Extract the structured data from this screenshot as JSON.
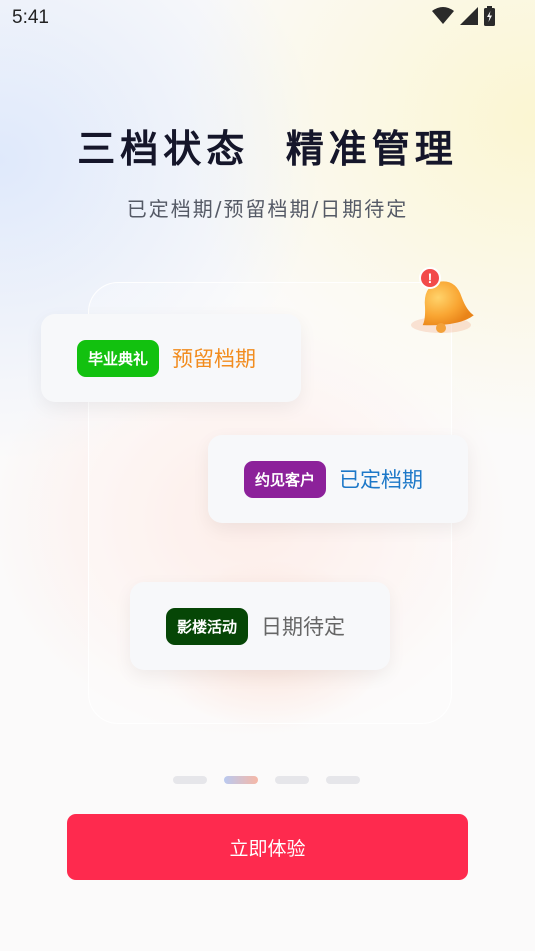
{
  "status_bar": {
    "time": "5:41",
    "icons": [
      "wifi-icon",
      "signal-icon",
      "battery-charging-icon"
    ]
  },
  "header": {
    "title": "三档状态  精准管理",
    "subtitle": "已定档期/预留档期/日期待定"
  },
  "cards": [
    {
      "tag": "毕业典礼",
      "tag_color": "#12c10f",
      "status": "预留档期",
      "status_color": "#f28c1e"
    },
    {
      "tag": "约见客户",
      "tag_color": "#8c219a",
      "status": "已定档期",
      "status_color": "#1d78c8"
    },
    {
      "tag": "影楼活动",
      "tag_color": "#064606",
      "status": "日期待定",
      "status_color": "#666666"
    }
  ],
  "pager": {
    "count": 4,
    "active_index": 1
  },
  "cta": {
    "label": "立即体验",
    "color": "#fe2a4e"
  },
  "notification": {
    "badge": "!",
    "icon": "bell-icon"
  }
}
